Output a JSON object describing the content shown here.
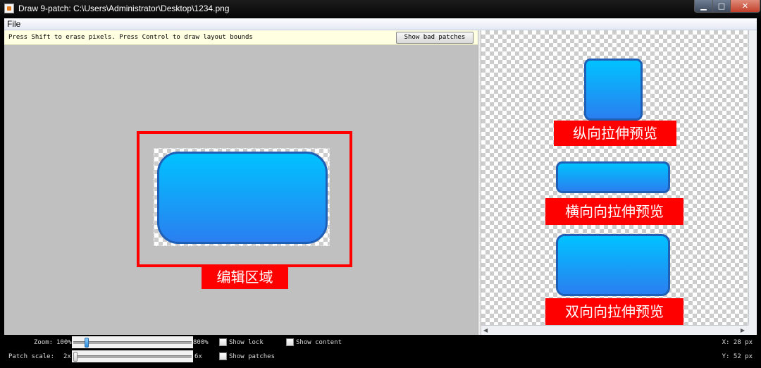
{
  "window": {
    "title": "Draw 9-patch: C:\\Users\\Administrator\\Desktop\\1234.png",
    "min_glyph": "▁",
    "max_glyph": "□",
    "close_glyph": "✕"
  },
  "menu": {
    "file": "File"
  },
  "editor": {
    "hint": "Press Shift to erase pixels. Press Control to draw layout bounds",
    "show_bad_patches": "Show bad patches",
    "edit_area_label": "编辑区域"
  },
  "preview": {
    "vertical_label": "纵向拉伸预览",
    "horizontal_label": "横向向拉伸预览",
    "both_label": "双向向拉伸预览",
    "scroll_left": "◀",
    "scroll_right": "▶"
  },
  "status": {
    "zoom_label": "Zoom:",
    "zoom_min": "100%",
    "zoom_max": "800%",
    "zoom_value": 0.1,
    "patch_scale_label": "Patch scale:",
    "patch_min": "2x",
    "patch_max": "6x",
    "patch_value": 0.0,
    "show_lock": "Show lock",
    "show_patches": "Show patches",
    "show_content": "Show content",
    "x_readout": "X: 28 px",
    "y_readout": "Y: 52 px"
  },
  "colors": {
    "button_top": "#00c2ff",
    "button_bottom": "#2a7ff0",
    "annotation_red": "#ff0000"
  }
}
